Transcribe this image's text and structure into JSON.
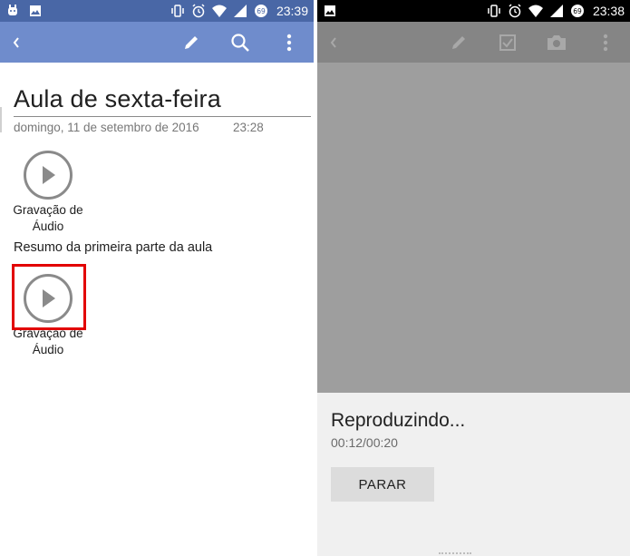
{
  "left": {
    "status_time": "23:39",
    "battery_level": "69",
    "note": {
      "title": "Aula de sexta-feira",
      "date": "domingo, 11 de setembro de 2016",
      "time": "23:28",
      "audio_label_1": "Gravação de Áudio",
      "text": "Resumo da primeira parte da aula",
      "audio_label_2": "Gravação de Áudio"
    },
    "colors": {
      "statusbar": "#4967a6",
      "appbar": "#6f8ccc",
      "highlight": "#e20000"
    },
    "icons": [
      "back-icon",
      "pencil-icon",
      "search-icon",
      "more-vert-icon"
    ]
  },
  "right": {
    "status_time": "23:38",
    "battery_level": "69",
    "player": {
      "status": "Reproduzindo...",
      "progress": "00:12/00:20",
      "stop_label": "PARAR"
    },
    "colors": {
      "statusbar": "#000000",
      "appbar": "#858585",
      "overlay": "#9e9e9e"
    },
    "icons": [
      "back-icon",
      "pencil-icon",
      "checkbox-icon",
      "camera-icon",
      "more-vert-icon"
    ]
  }
}
